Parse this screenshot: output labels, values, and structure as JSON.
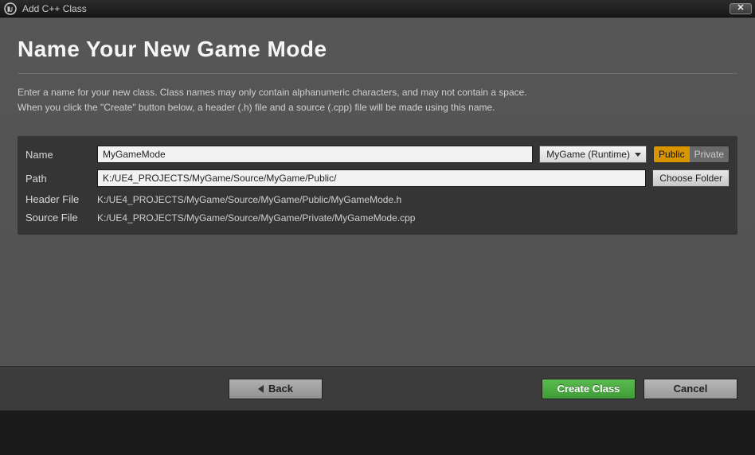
{
  "window": {
    "title": "Add C++ Class"
  },
  "heading": "Name Your New Game Mode",
  "description_line1": "Enter a name for your new class. Class names may only contain alphanumeric characters, and may not contain a space.",
  "description_line2": "When you click the \"Create\" button below, a header (.h) file and a source (.cpp) file will be made using this name.",
  "form": {
    "name_label": "Name",
    "name_value": "MyGameMode",
    "module_value": "MyGame (Runtime)",
    "visibility": {
      "public": "Public",
      "private": "Private",
      "active": "Public"
    },
    "path_label": "Path",
    "path_value": "K:/UE4_PROJECTS/MyGame/Source/MyGame/Public/",
    "choose_folder": "Choose Folder",
    "header_label": "Header File",
    "header_value": "K:/UE4_PROJECTS/MyGame/Source/MyGame/Public/MyGameMode.h",
    "source_label": "Source File",
    "source_value": "K:/UE4_PROJECTS/MyGame/Source/MyGame/Private/MyGameMode.cpp"
  },
  "buttons": {
    "back": "Back",
    "create": "Create Class",
    "cancel": "Cancel"
  }
}
